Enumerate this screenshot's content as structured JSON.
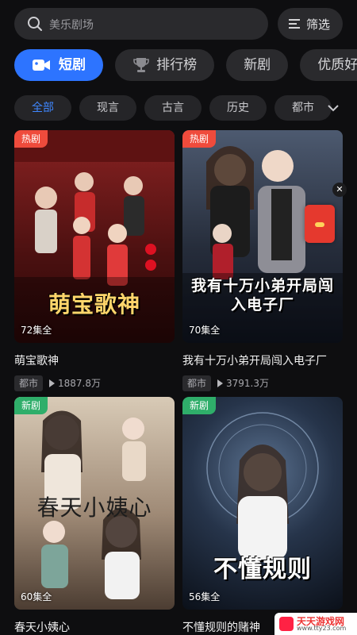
{
  "search": {
    "placeholder": "美乐剧场"
  },
  "filter": {
    "label": "筛选"
  },
  "tabs": [
    {
      "label": "短剧",
      "icon": "video-camera-icon",
      "active": true
    },
    {
      "label": "排行榜",
      "icon": "trophy-icon"
    },
    {
      "label": "新剧"
    },
    {
      "label": "优质好剧"
    }
  ],
  "categories": [
    {
      "label": "全部",
      "active": true
    },
    {
      "label": "现言"
    },
    {
      "label": "古言"
    },
    {
      "label": "历史"
    },
    {
      "label": "都市"
    }
  ],
  "dramas": [
    {
      "badge": "热剧",
      "badge_type": "hot",
      "poster_title": "萌宝歌神",
      "episodes": "72集全",
      "title": "萌宝歌神",
      "tag": "都市",
      "views": "1887.8万",
      "colors": [
        "#7a1f1f",
        "#3a0c0c"
      ]
    },
    {
      "badge": "热剧",
      "badge_type": "hot",
      "poster_title": "我有十万小弟开局闯入电子厂",
      "episodes": "70集全",
      "title": "我有十万小弟开局闯入电子厂",
      "tag": "都市",
      "views": "3791.3万",
      "colors": [
        "#3f4a5c",
        "#1b2230"
      ]
    },
    {
      "badge": "新剧",
      "badge_type": "new",
      "poster_title": "春天小姨心",
      "episodes": "60集全",
      "title": "春天小姨心",
      "tag": "",
      "views": "",
      "colors": [
        "#c9b8a3",
        "#6e5a4a"
      ]
    },
    {
      "badge": "新剧",
      "badge_type": "new",
      "poster_title": "不懂规则",
      "episodes": "56集全",
      "title": "不懂规则的赌神",
      "tag": "",
      "views": "",
      "colors": [
        "#2e3c4e",
        "#0f151e"
      ]
    }
  ],
  "watermark": {
    "brand": "天天游戏网",
    "url": "www.tty23.com"
  }
}
